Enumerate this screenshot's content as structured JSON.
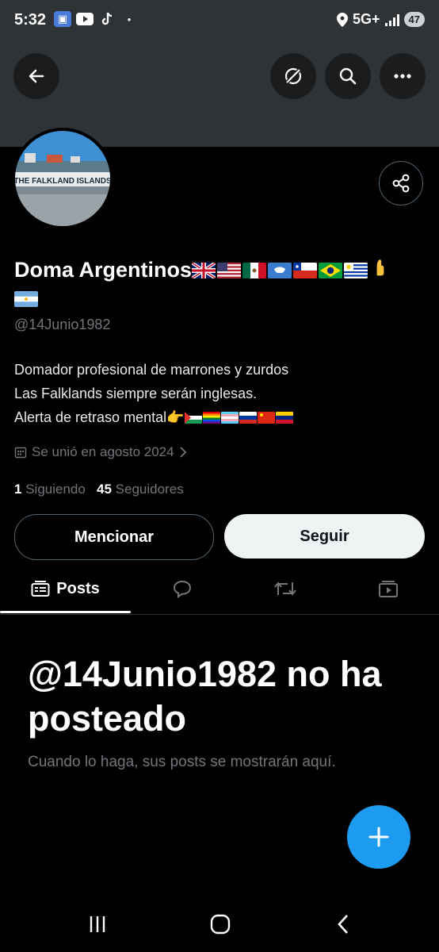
{
  "status": {
    "time": "5:32",
    "network": "5G+",
    "battery": "47"
  },
  "profile": {
    "name": "Doma Argentinos",
    "handle": "@14Junio1982",
    "avatar_caption": "THE FALKLAND ISLANDS",
    "bio": [
      "Domador profesional de marrones y zurdos",
      "Las Falklands siempre serán inglesas.",
      "Alerta de retraso mental"
    ],
    "joined": "Se unió en agosto 2024",
    "following_count": "1",
    "following_label": "Siguiendo",
    "followers_count": "45",
    "followers_label": "Seguidores"
  },
  "actions": {
    "mention": "Mencionar",
    "follow": "Seguir"
  },
  "tabs": {
    "posts": "Posts"
  },
  "empty": {
    "title": "@14Junio1982 no ha posteado",
    "subtitle": "Cuando lo haga, sus posts se mostrarán aquí."
  },
  "colors": {
    "accent": "#1d9bf0",
    "header_bg": "#2f3336"
  },
  "icons": [
    "back-arrow-icon",
    "grok-icon",
    "search-icon",
    "more-icon",
    "share-icon",
    "calendar-icon",
    "chevron-right-icon",
    "posts-icon",
    "replies-icon",
    "reposts-icon",
    "media-icon",
    "compose-plus-icon"
  ]
}
